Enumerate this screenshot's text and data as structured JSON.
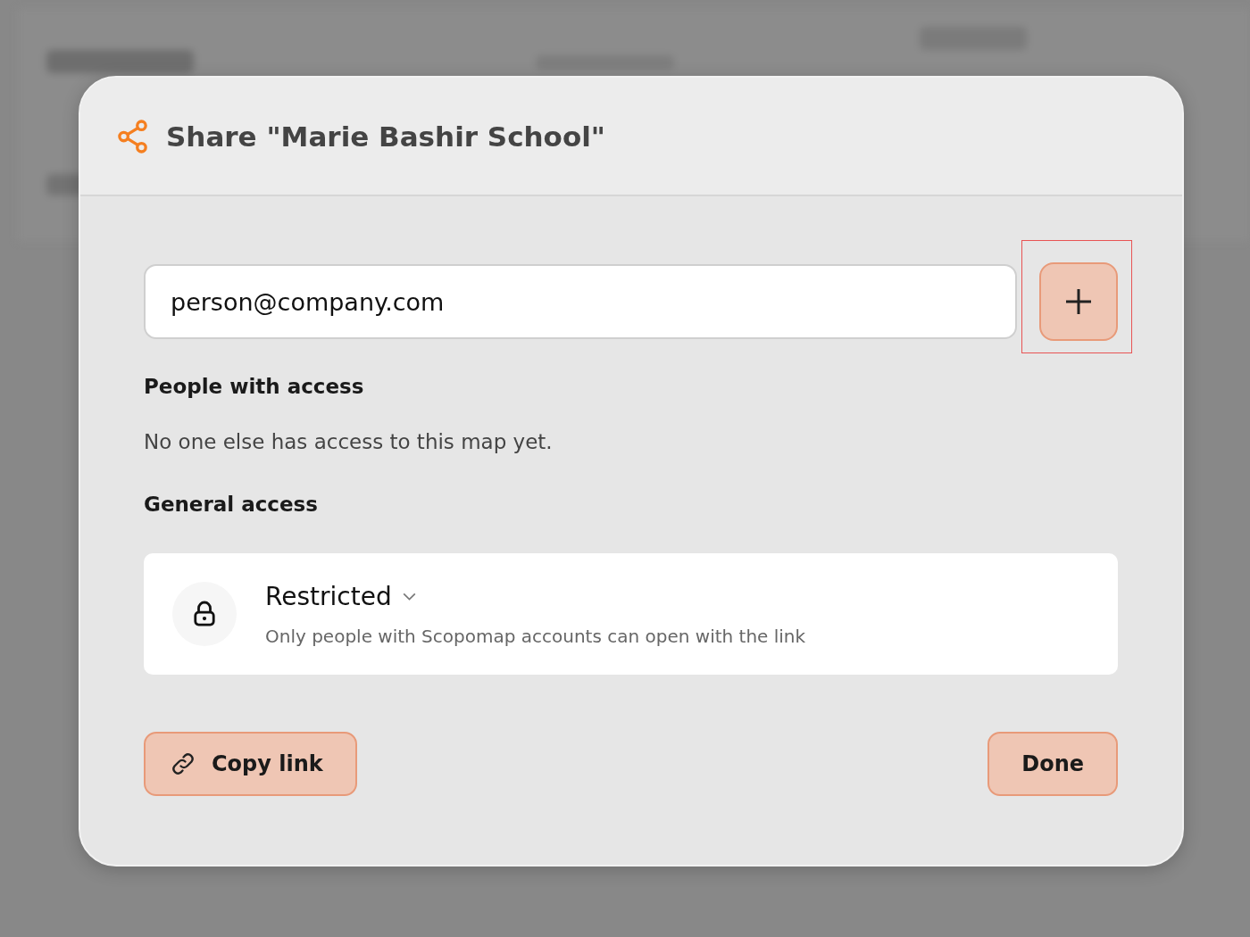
{
  "dialog": {
    "title": "Share \"Marie Bashir School\""
  },
  "email_field": {
    "value": "person@company.com"
  },
  "add_button": {
    "highlighted": true
  },
  "people_section": {
    "heading": "People with access",
    "message": "No one else has access to this map yet."
  },
  "general_access": {
    "heading": "General access",
    "setting": "Restricted",
    "description": "Only people with Scopomap accounts can open with the link"
  },
  "buttons": [
    {
      "kind": "copy",
      "label": "Copy link"
    },
    {
      "kind": "done",
      "label": "Done"
    }
  ]
}
